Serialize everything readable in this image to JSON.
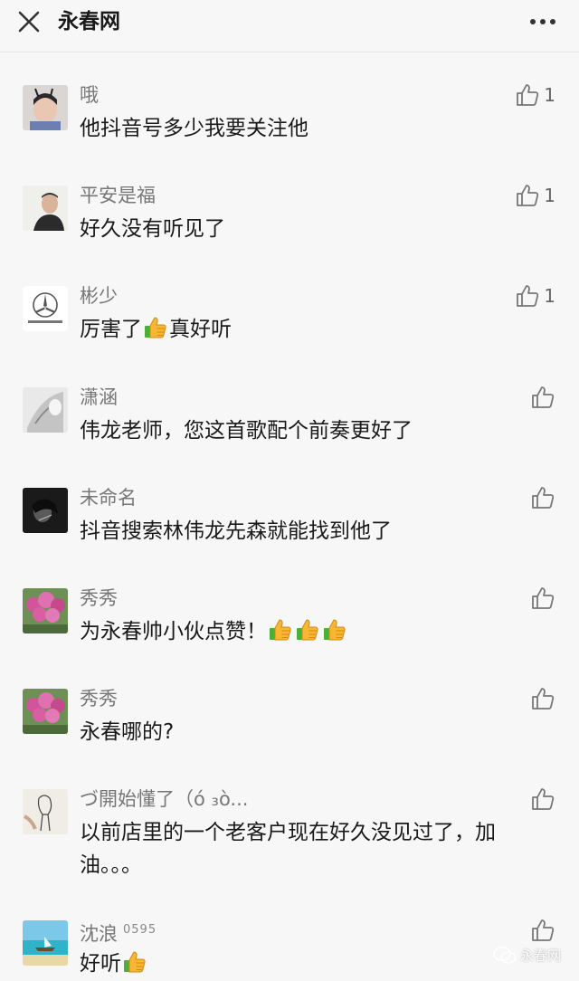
{
  "header": {
    "title": "永春网",
    "close_icon": "close-icon",
    "more_icon": "more-icon"
  },
  "comments": [
    {
      "nick": "哦",
      "text": "他抖音号多少我要关注他",
      "likes": "1"
    },
    {
      "nick": "平安是福",
      "text": "好久没有听见了",
      "likes": "1"
    },
    {
      "nick": "彬少",
      "text_before": "厉害了",
      "text_after": "真好听",
      "likes": "1"
    },
    {
      "nick": "潇涵",
      "text": "伟龙老师，您这首歌配个前奏更好了"
    },
    {
      "nick": "未命名",
      "text": "抖音搜索林伟龙先森就能找到他了"
    },
    {
      "nick": "秀秀",
      "text": "为永春帅小伙点赞！"
    },
    {
      "nick": "秀秀",
      "text": "永春哪的?"
    },
    {
      "nick": "づ開始懂了（ó ₃ò...",
      "text": "以前店里的一个老客户现在好久没见过了，加油。。。"
    },
    {
      "nick": "沈浪",
      "badge": "0595",
      "text": "好听"
    }
  ],
  "watermark": {
    "label": "永春网"
  },
  "colors": {
    "background": "#f7f7f7",
    "nick": "#777777",
    "text": "#1a1a1a",
    "icon": "#777777"
  }
}
